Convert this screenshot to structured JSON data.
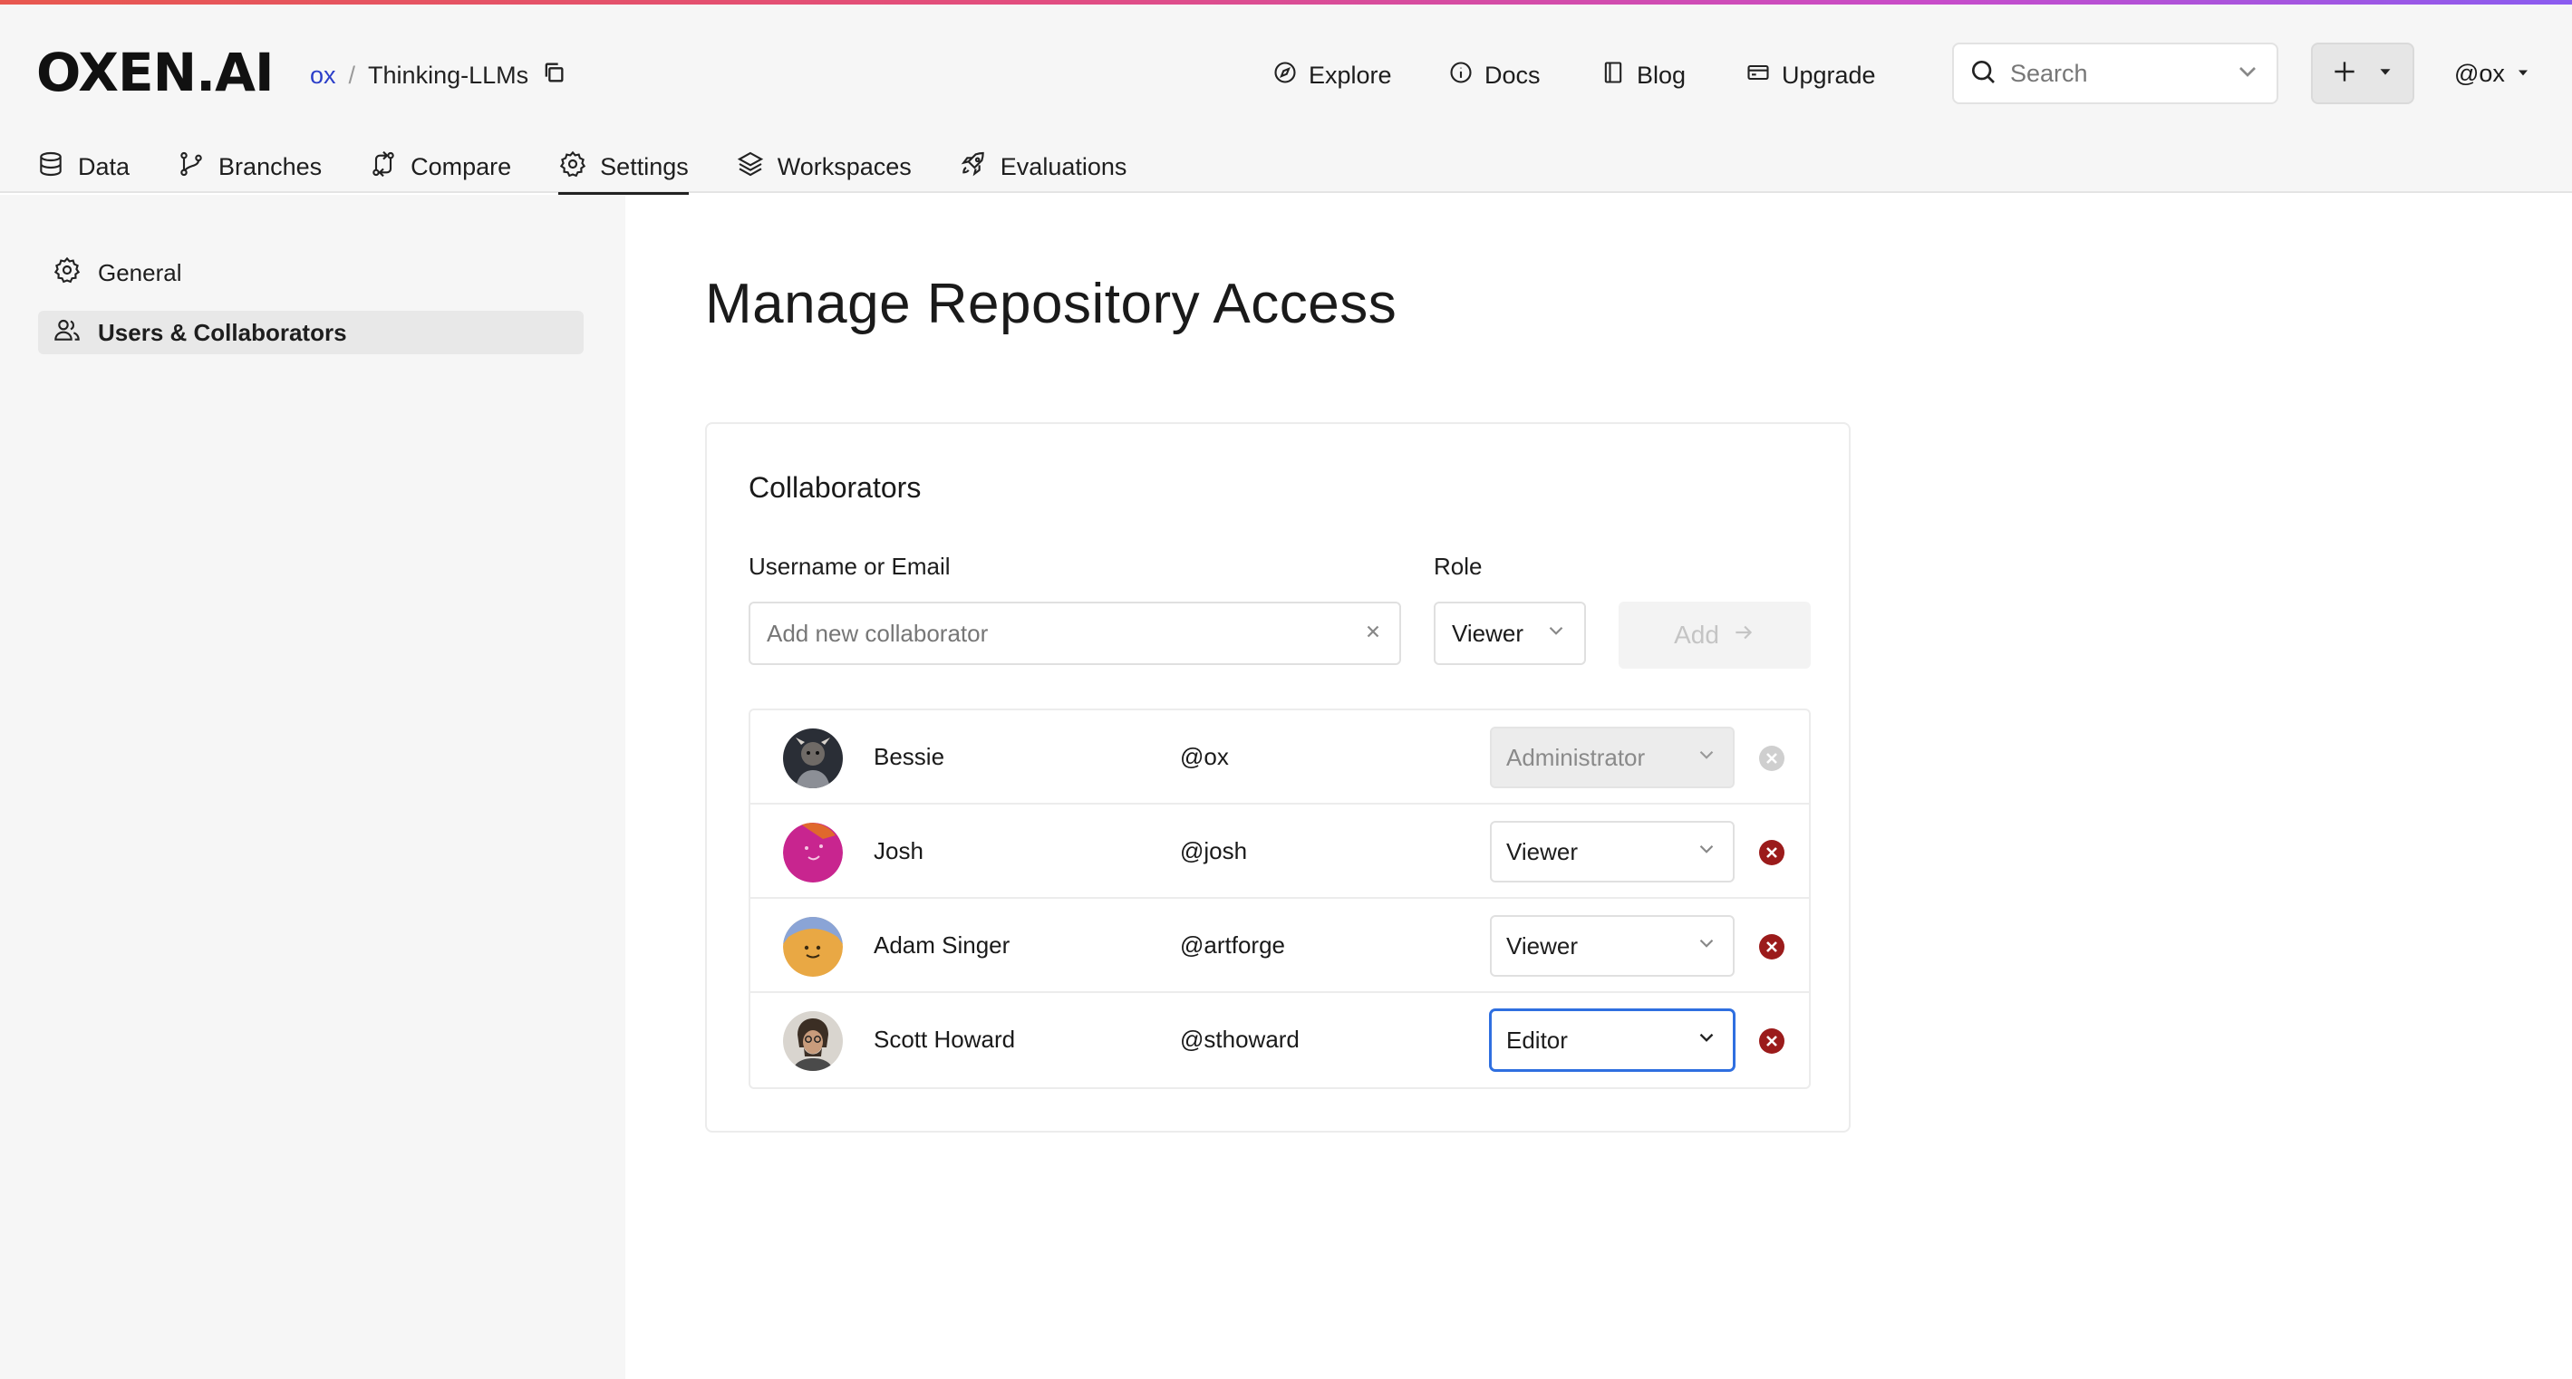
{
  "brand": {
    "logo": "OXEN.AI"
  },
  "breadcrumb": {
    "owner": "ox",
    "separator": "/",
    "repo": "Thinking-LLMs"
  },
  "topnav": {
    "explore": "Explore",
    "docs": "Docs",
    "blog": "Blog",
    "upgrade": "Upgrade"
  },
  "search": {
    "placeholder": "Search"
  },
  "user_menu": {
    "label": "@ox"
  },
  "tabs": [
    {
      "label": "Data",
      "icon": "database-icon"
    },
    {
      "label": "Branches",
      "icon": "branch-icon"
    },
    {
      "label": "Compare",
      "icon": "compare-icon"
    },
    {
      "label": "Settings",
      "icon": "gear-icon",
      "active": true
    },
    {
      "label": "Workspaces",
      "icon": "layers-icon"
    },
    {
      "label": "Evaluations",
      "icon": "rocket-icon"
    }
  ],
  "sidebar": {
    "items": [
      {
        "label": "General",
        "icon": "gear-icon"
      },
      {
        "label": "Users & Collaborators",
        "icon": "users-icon",
        "active": true
      }
    ]
  },
  "main": {
    "title": "Manage Repository Access",
    "card_title": "Collaborators",
    "username_label": "Username or Email",
    "username_placeholder": "Add new collaborator",
    "role_label": "Role",
    "role_value": "Viewer",
    "add_label": "Add"
  },
  "collaborators": [
    {
      "name": "Bessie",
      "handle": "@ox",
      "role": "Administrator",
      "editable": false
    },
    {
      "name": "Josh",
      "handle": "@josh",
      "role": "Viewer",
      "editable": true
    },
    {
      "name": "Adam Singer",
      "handle": "@artforge",
      "role": "Viewer",
      "editable": true
    },
    {
      "name": "Scott Howard",
      "handle": "@sthoward",
      "role": "Editor",
      "editable": true,
      "focused": true
    }
  ],
  "colors": {
    "accent_gradient": [
      "#e8584f",
      "#e24d7f",
      "#c84cc9",
      "#8a5cf0"
    ],
    "owner_link": "#2c3fc9",
    "remove_red": "#9b1b1b",
    "focus_blue": "#2f6fe0"
  }
}
